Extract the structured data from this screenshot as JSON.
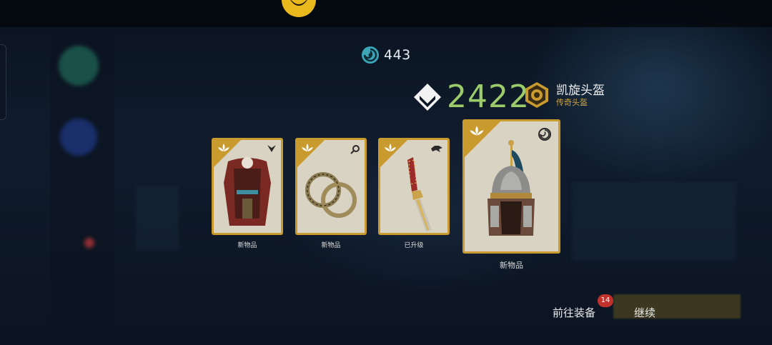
{
  "currency": {
    "icon": "swirl-orb-icon",
    "value": "443"
  },
  "gear_score": {
    "icon": "diamond-chevron-icon",
    "value": "2422"
  },
  "item": {
    "name": "凯旋头盔",
    "rarity": "传奇头盔",
    "icon": "lion-crest-icon"
  },
  "cards": [
    {
      "label": "新物品",
      "art": "chest-armor",
      "type_icon": "chevron-down-icon"
    },
    {
      "label": "新物品",
      "art": "dragon-ring",
      "type_icon": "magnifier-icon"
    },
    {
      "label": "已升级",
      "art": "sword",
      "type_icon": "beast-head-icon"
    },
    {
      "label": "新物品",
      "art": "helmet",
      "type_icon": "swirl-icon"
    }
  ],
  "actions": {
    "equip_label": "前往装备",
    "equip_badge": "14",
    "continue_label": "继续"
  },
  "colors": {
    "gold": "#c99a2e",
    "score_green": "#9ccb6b",
    "rarity_gold": "#d2a63a",
    "badge_red": "#c0312b"
  }
}
